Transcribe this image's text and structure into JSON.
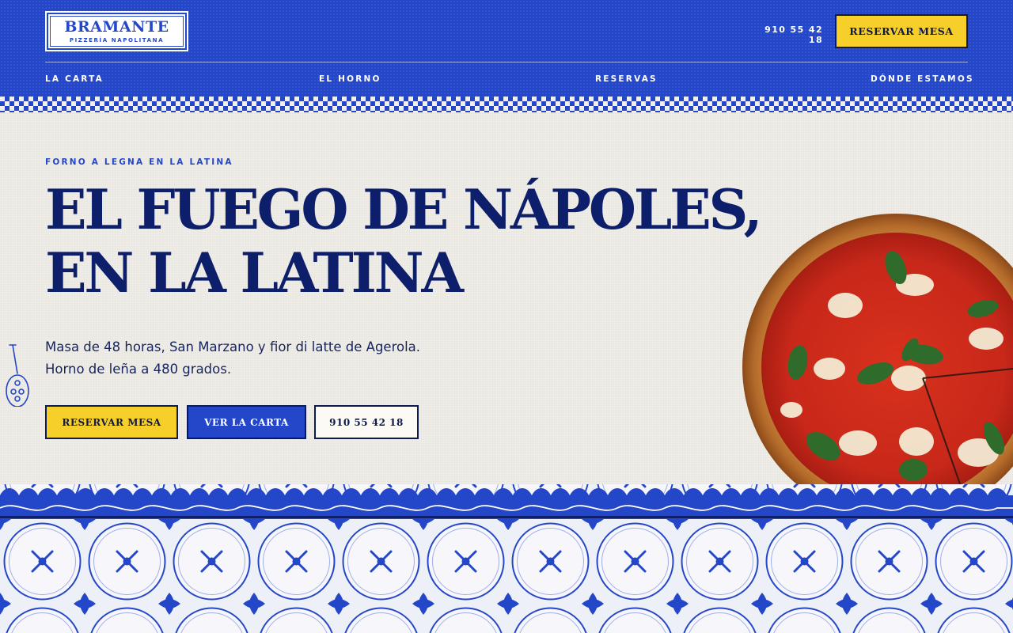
{
  "brand": {
    "name": "BRAMANTE",
    "tagline": "PIZZERÍA NAPOLITANA"
  },
  "header": {
    "phone": "910 55 42 18",
    "reserve_label": "RESERVAR MESA"
  },
  "nav": {
    "items": [
      {
        "label": "LA CARTA"
      },
      {
        "label": "EL HORNO"
      },
      {
        "label": "RESERVAS"
      },
      {
        "label": "DÓNDE ESTAMOS"
      }
    ]
  },
  "hero": {
    "eyebrow": "FORNO A LEGNA EN LA LATINA",
    "headline_line1": "EL FUEGO DE NÁPOLES,",
    "headline_line2": "EN LA LATINA",
    "sub_line1": "Masa de 48 horas, San Marzano y fior di latte de Agerola.",
    "sub_line2": "Horno de leña a 480 grados.",
    "buttons": {
      "reserve": "RESERVAR MESA",
      "menu": "VER LA CARTA",
      "phone": "910 55 42 18"
    }
  },
  "icons": {
    "peel": "pizza-peel-icon"
  },
  "colors": {
    "primary_blue": "#2447c9",
    "navy": "#0d1e6b",
    "yellow": "#f7cf2b",
    "cream": "#f1efe8"
  }
}
